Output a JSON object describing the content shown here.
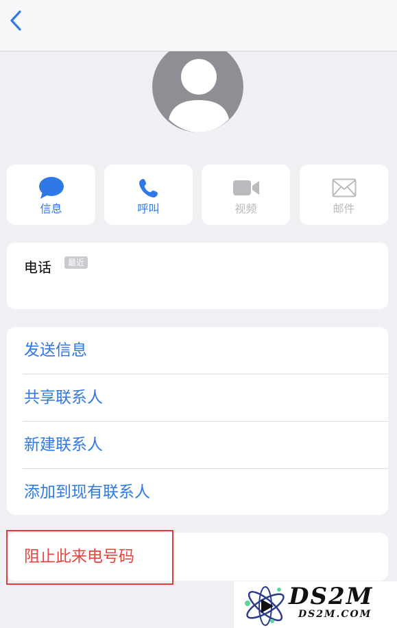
{
  "actions": {
    "message": "信息",
    "call": "呼叫",
    "video": "视频",
    "mail": "邮件"
  },
  "phone": {
    "title": "电话",
    "badge": "最近"
  },
  "options": {
    "send_message": "发送信息",
    "share_contact": "共享联系人",
    "new_contact": "新建联系人",
    "add_existing": "添加到现有联系人"
  },
  "block": {
    "label": "阻止此来电号码"
  },
  "watermark": {
    "main": "DS2M",
    "sub": "DS2M.COM"
  },
  "colors": {
    "accent": "#2f78e6",
    "danger": "#e5453d",
    "disabled": "#b9b9be"
  }
}
